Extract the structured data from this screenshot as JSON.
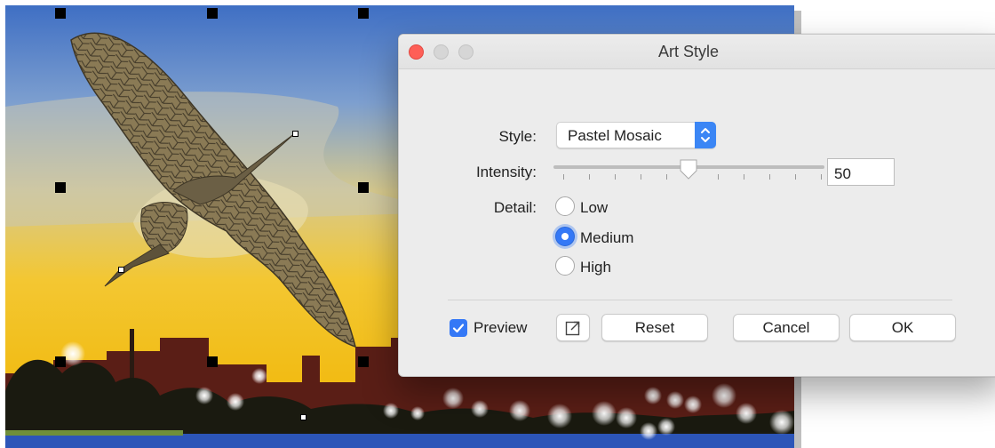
{
  "dialog": {
    "title": "Art Style",
    "style": {
      "label": "Style:",
      "value": "Pastel Mosaic"
    },
    "intensity": {
      "label": "Intensity:",
      "value": "50",
      "level_percent": 50
    },
    "detail": {
      "label": "Detail:",
      "options": [
        "Low",
        "Medium",
        "High"
      ],
      "selected": "Medium"
    },
    "preview": {
      "label": "Preview",
      "checked": true
    },
    "buttons": {
      "reset": "Reset",
      "cancel": "Cancel",
      "ok": "OK"
    },
    "icons": {
      "close": "close-icon",
      "minimize": "minimize-icon",
      "zoom": "zoom-icon",
      "stepper": "chevron-updown-icon",
      "slider_thumb": "slider-thumb-icon",
      "checkmark": "checkmark-icon",
      "edit": "edit-external-icon"
    },
    "colors": {
      "accent": "#3478f6",
      "close": "#fe5f57",
      "inactive_light": "#d6d6d6"
    }
  }
}
